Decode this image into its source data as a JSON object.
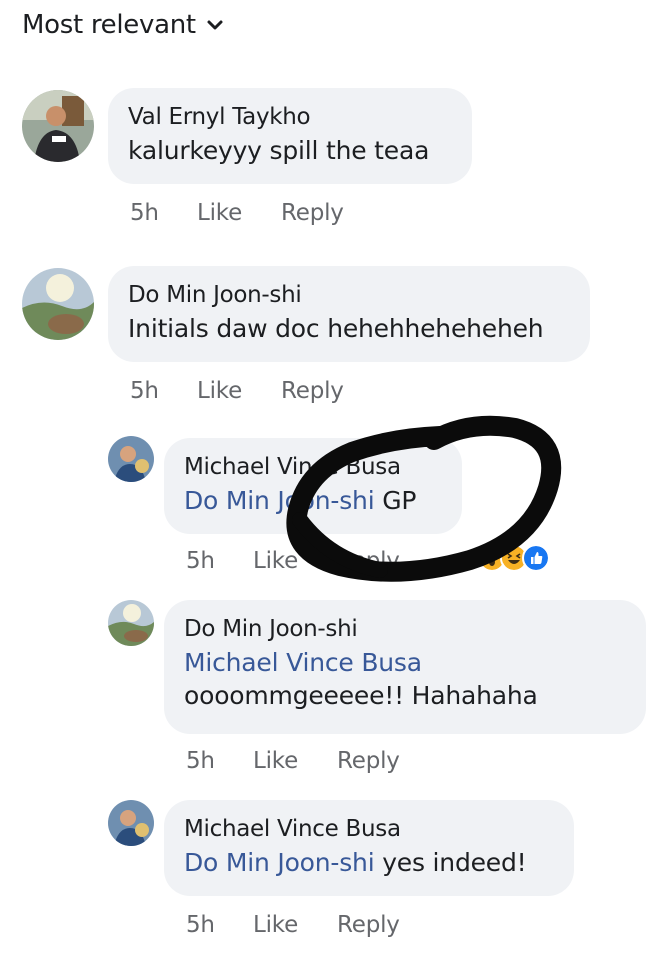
{
  "sort": {
    "label": "Most relevant"
  },
  "comments": [
    {
      "author": "Val Ernyl Taykho",
      "mention": "",
      "text": "kalurkeyyy spill the teaa",
      "time": "5h",
      "like": "Like",
      "reply": "Reply"
    },
    {
      "author": "Do Min Joon-shi",
      "mention": "",
      "text": "Initials daw doc hehehheheheheh",
      "time": "5h",
      "like": "Like",
      "reply": "Reply"
    },
    {
      "author": "Michael Vince Busa",
      "mention": "Do Min Joon-shi",
      "text": " GP",
      "time": "5h",
      "like": "Like",
      "reply": "Reply"
    },
    {
      "author": "Do Min Joon-shi",
      "mention": "Michael Vince Busa",
      "text": "oooommgeeeee!! Hahahaha",
      "time": "5h",
      "like": "Like",
      "reply": "Reply"
    },
    {
      "author": "Michael Vince Busa",
      "mention": "Do Min Joon-shi",
      "text": " yes indeed!",
      "time": "5h",
      "like": "Like",
      "reply": "Reply"
    }
  ],
  "reactions": [
    "wow-icon",
    "haha-icon",
    "like-icon"
  ],
  "colors": {
    "bubble": "#f0f2f5",
    "mention": "#385898",
    "meta": "#65676b",
    "like_blue": "#1877f2",
    "reaction_yellow": "#f7b125"
  }
}
